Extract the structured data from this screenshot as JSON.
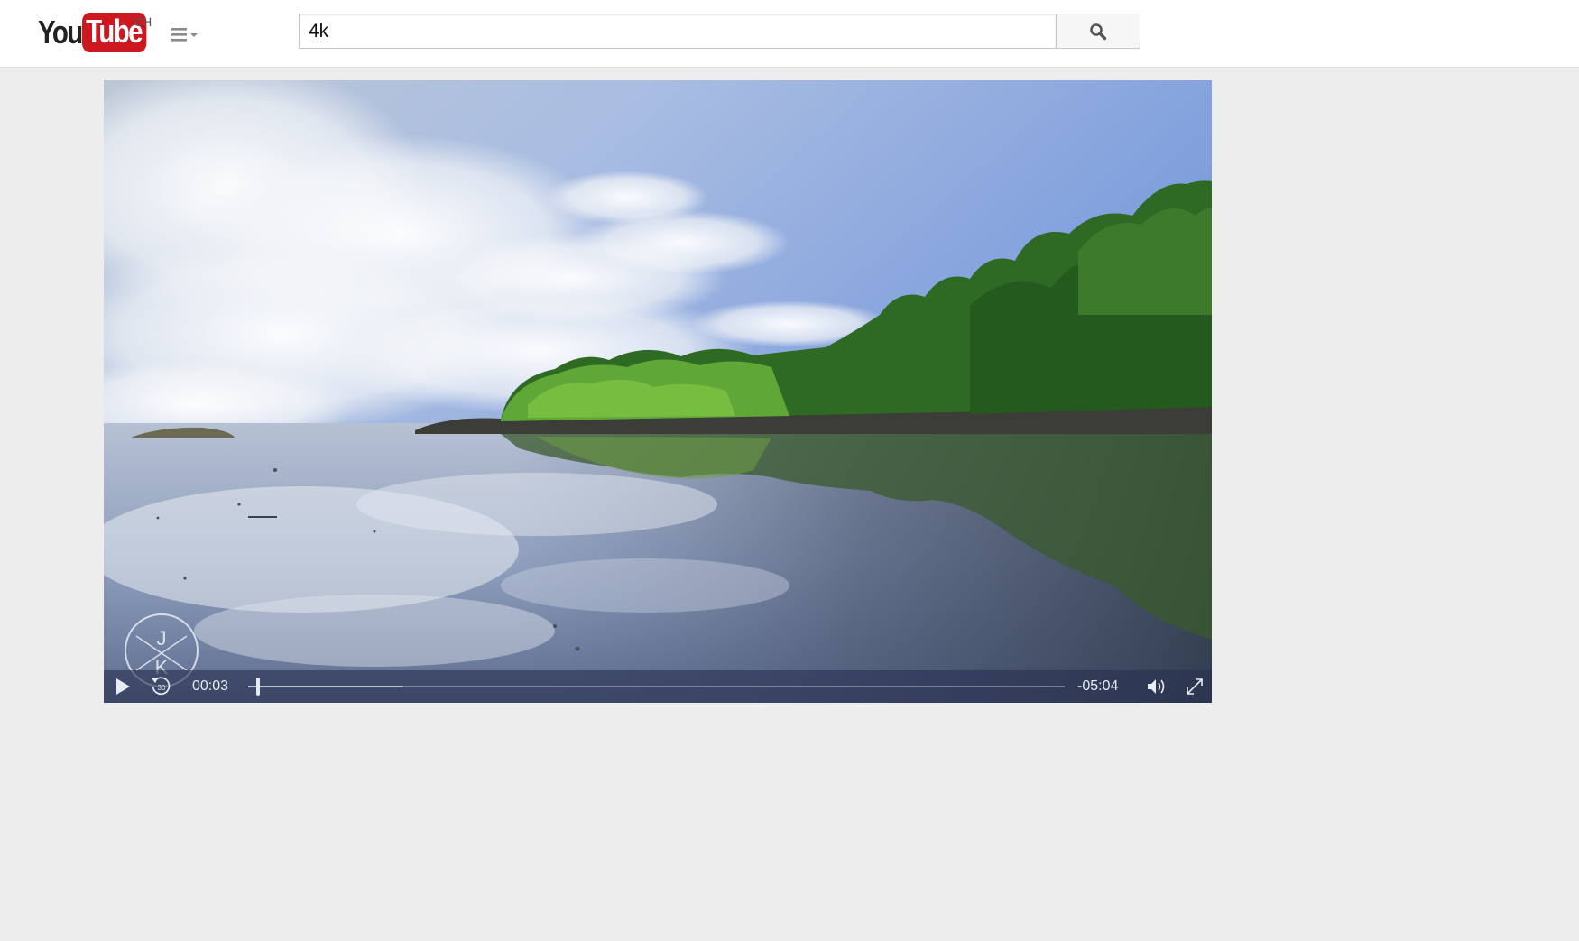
{
  "masthead": {
    "logo_you": "You",
    "logo_tube": "Tube",
    "country_code": "CH",
    "search": {
      "value": "4k"
    }
  },
  "player": {
    "current_time": "00:03",
    "remaining_time": "-05:04",
    "skip_back_label": "30",
    "watermark_letters": [
      "J",
      "K"
    ],
    "progress_fraction": 0.012,
    "buffered_fraction": 0.19
  },
  "icons": {
    "guide": "menu-icon",
    "search": "search-icon",
    "play": "play-icon",
    "skip_back": "rewind-30-icon",
    "volume": "volume-icon",
    "fullscreen": "fullscreen-icon"
  }
}
